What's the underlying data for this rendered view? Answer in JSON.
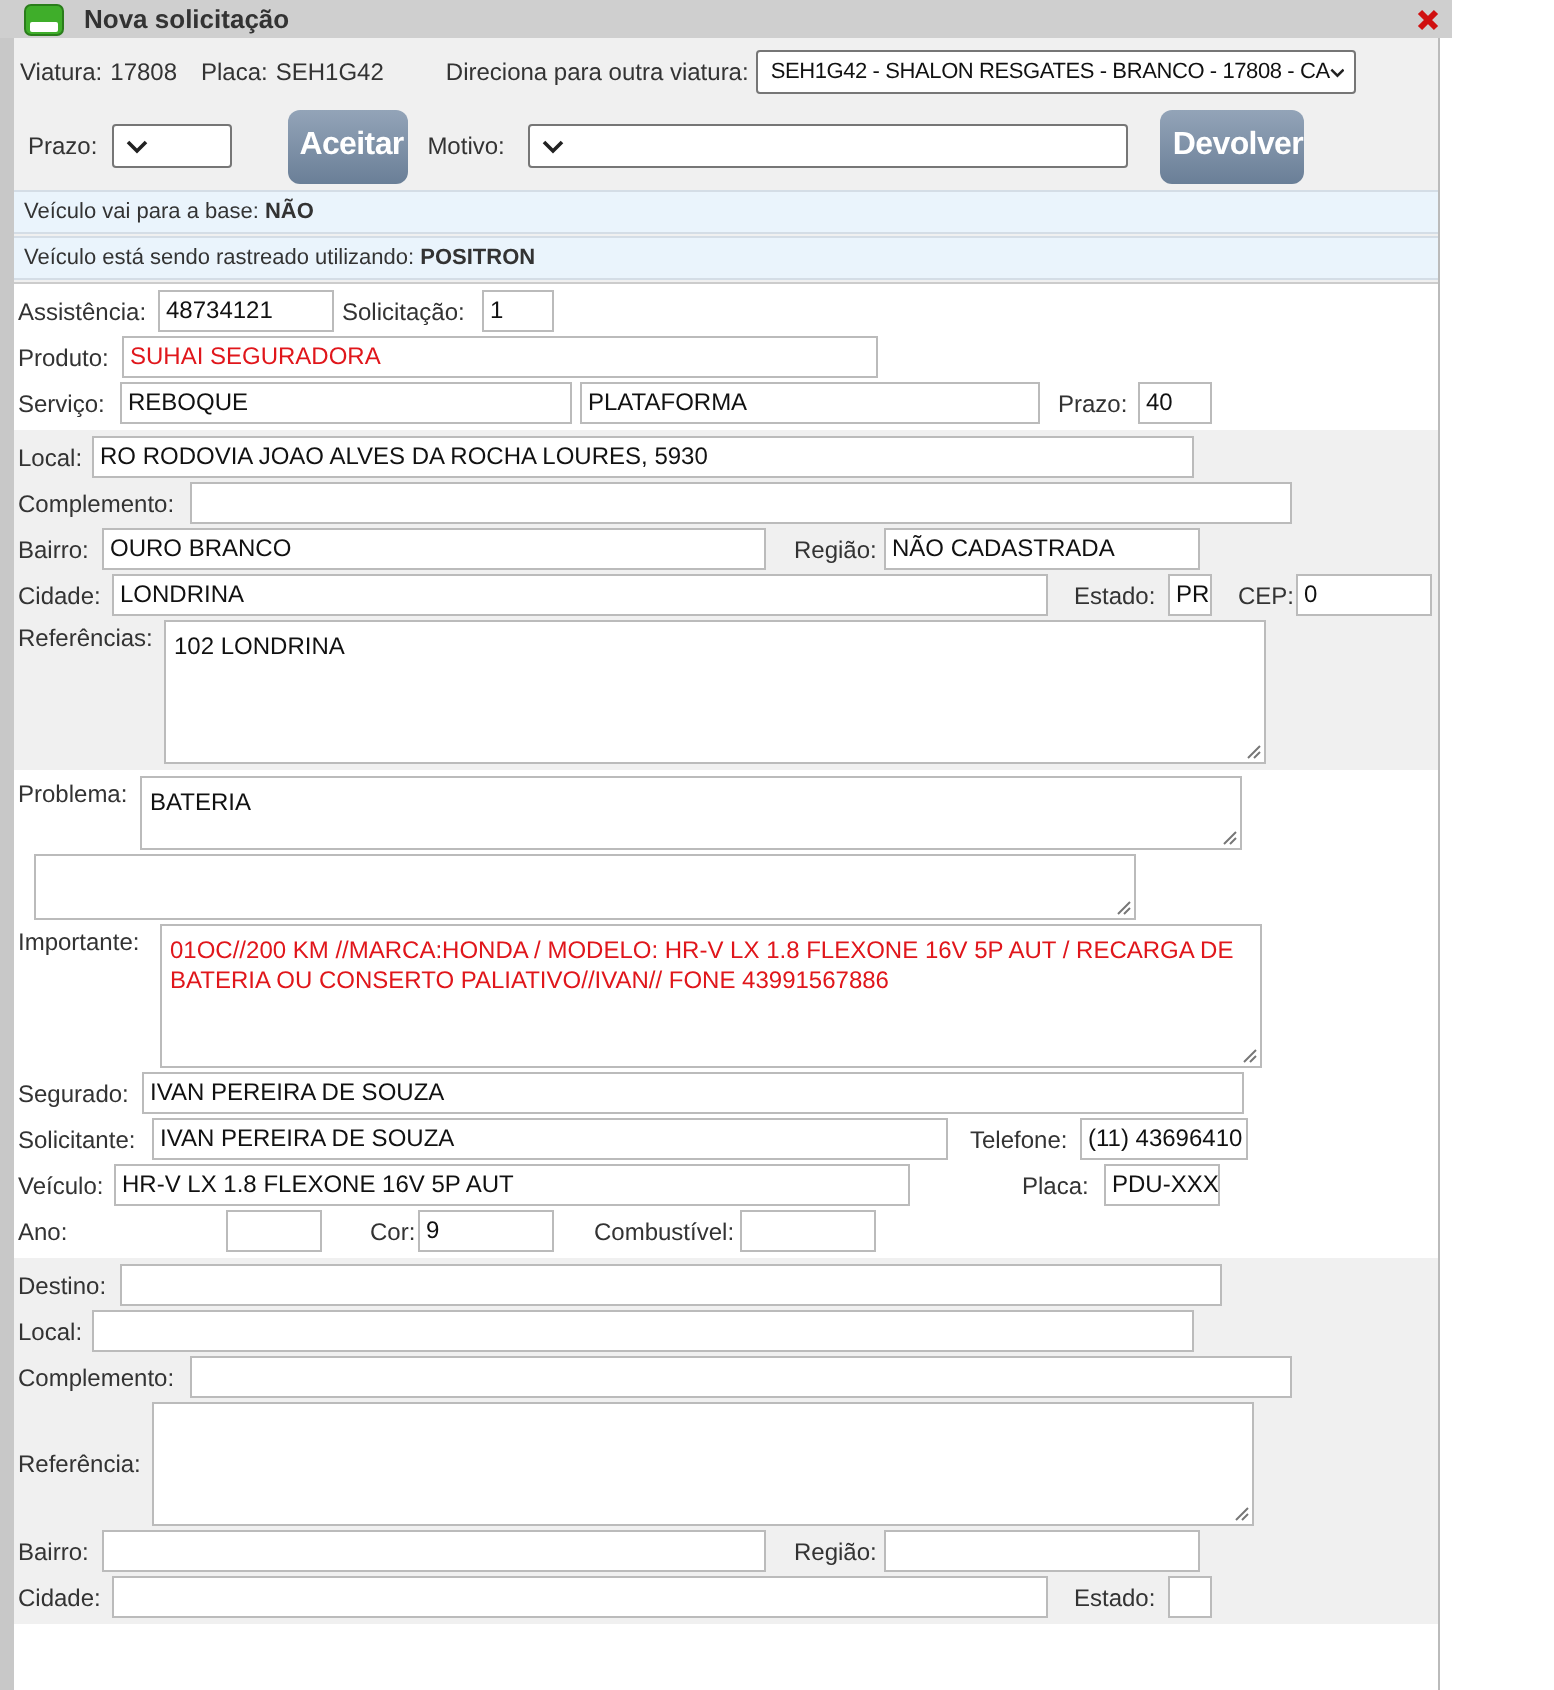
{
  "window": {
    "title": "Nova solicitação"
  },
  "header": {
    "viatura_label": "Viatura:",
    "viatura": "17808",
    "placa_label": "Placa:",
    "placa": "SEH1G42",
    "redirect_label": "Direciona para outra viatura:",
    "redirect_value": "SEH1G42 - SHALON RESGATES - BRANCO - 17808 - CA",
    "prazo_label": "Prazo:",
    "accept_button": "Aceitar",
    "motivo_label": "Motivo:",
    "return_button": "Devolver"
  },
  "notices": [
    "Veículo vai para a base: **NÃO**",
    "Veículo está sendo rastreado utilizando: **POSITRON**"
  ],
  "sections": [
    {
      "shaded": false,
      "rows": [
        {
          "fields": [
            {
              "label": "Assistência:",
              "kind": "input",
              "value": "48734121",
              "alert": false
            },
            {
              "label": "Solicitação:",
              "kind": "input",
              "value": "1",
              "alert": false
            }
          ]
        },
        {
          "fields": [
            {
              "label": "Produto:",
              "kind": "input",
              "value": "SUHAI SEGURADORA",
              "alert": true
            }
          ]
        },
        {
          "fields": [
            {
              "label": "Serviço:",
              "kind": "input",
              "value": "REBOQUE",
              "alert": false
            },
            {
              "kind": "input",
              "value": "PLATAFORMA",
              "alert": false
            },
            {
              "label": "Prazo:",
              "kind": "input",
              "value": "40",
              "alert": false
            }
          ]
        }
      ]
    },
    {
      "shaded": true,
      "rows": [
        {
          "fields": [
            {
              "label": "Local:",
              "kind": "input",
              "value": "RO RODOVIA JOAO ALVES DA ROCHA LOURES, 5930",
              "alert": false
            }
          ]
        },
        {
          "fields": [
            {
              "label": "Complemento:",
              "kind": "input"
            }
          ]
        },
        {
          "fields": [
            {
              "label": "Bairro:",
              "kind": "input",
              "value": "OURO BRANCO",
              "alert": false
            },
            {
              "label": "Região:",
              "kind": "input",
              "value": "NÃO CADASTRADA",
              "alert": false
            }
          ]
        },
        {
          "fields": [
            {
              "label": "Cidade:",
              "kind": "input",
              "value": "LONDRINA",
              "alert": false
            },
            {
              "label": "Estado:",
              "kind": "input",
              "value": "PR",
              "alert": false
            },
            {
              "label": "CEP:",
              "kind": "input",
              "value": "0",
              "alert": false
            }
          ]
        },
        {
          "fields": [
            {
              "label": "Referências:",
              "kind": "textarea",
              "value": "102 LONDRINA",
              "alert": false
            }
          ]
        }
      ]
    },
    {
      "shaded": false,
      "rows": [
        {
          "fields": [
            {
              "label": "Problema:",
              "kind": "textarea",
              "value": "BATERIA",
              "alert": false
            }
          ]
        },
        {
          "fields": [
            {
              "kind": "textarea"
            }
          ]
        },
        {
          "fields": [
            {
              "label": "Importante:",
              "kind": "textarea",
              "value": "01OC//200 KM //MARCA:HONDA / MODELO:  HR-V LX 1.8 FLEXONE 16V 5P AUT  / RECARGA DE BATERIA OU CONSERTO PALIATIVO//IVAN// FONE 43991567886",
              "alert": true
            }
          ]
        },
        {
          "fields": [
            {
              "label": "Segurado:",
              "kind": "input",
              "value": "IVAN PEREIRA DE SOUZA",
              "alert": false
            }
          ]
        },
        {
          "fields": [
            {
              "label": "Solicitante:",
              "kind": "input",
              "value": "IVAN PEREIRA DE SOUZA",
              "alert": false
            },
            {
              "label": "Telefone:",
              "kind": "input",
              "value": "(11) 43696410",
              "alert": false
            }
          ]
        },
        {
          "fields": [
            {
              "label": "Veículo:",
              "kind": "input",
              "value": "HR-V LX 1.8 FLEXONE 16V 5P AUT",
              "alert": false
            },
            {
              "label": "Placa:",
              "kind": "input",
              "value": "PDU-XXX",
              "alert": false
            }
          ]
        },
        {
          "fields": [
            {
              "label": "Ano:",
              "kind": "input"
            },
            {
              "label": "Cor:",
              "kind": "input",
              "value": "9",
              "alert": false
            },
            {
              "label": "Combustível:",
              "kind": "input"
            }
          ]
        }
      ]
    },
    {
      "shaded": true,
      "rows": [
        {
          "fields": [
            {
              "label": "Destino:",
              "kind": "input"
            }
          ]
        },
        {
          "fields": [
            {
              "label": "Local:",
              "kind": "input"
            }
          ]
        },
        {
          "fields": [
            {
              "label": "Complemento:",
              "kind": "input"
            }
          ]
        },
        {
          "fields": [
            {
              "label": "Referência:",
              "kind": "textarea"
            }
          ]
        },
        {
          "fields": [
            {
              "label": "Bairro:",
              "kind": "input"
            },
            {
              "label": "Região:",
              "kind": "input"
            }
          ]
        },
        {
          "fields": [
            {
              "label": "Cidade:",
              "kind": "input"
            },
            {
              "label": "Estado:",
              "kind": "input"
            }
          ]
        }
      ]
    }
  ]
}
